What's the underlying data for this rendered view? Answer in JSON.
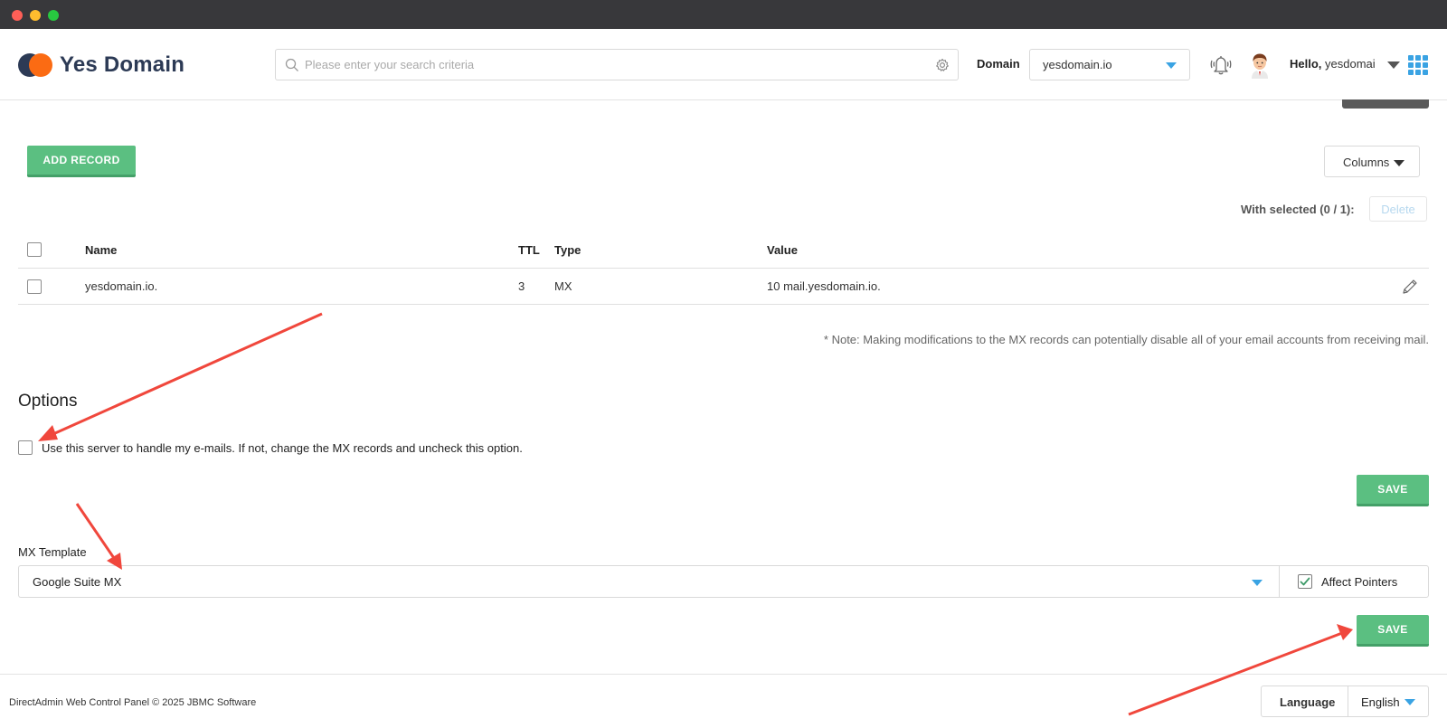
{
  "brand": {
    "name": "Yes Domain"
  },
  "search": {
    "placeholder": "Please enter your search criteria"
  },
  "header": {
    "domain_label": "Domain",
    "domain_value": "yesdomain.io",
    "hello_prefix": "Hello,",
    "username": "yesdomai"
  },
  "toolbar": {
    "add_record": "ADD RECORD",
    "columns": "Columns",
    "with_selected": "With selected (0 / 1):",
    "delete": "Delete"
  },
  "table": {
    "headers": {
      "name": "Name",
      "ttl": "TTL",
      "type": "Type",
      "value": "Value"
    },
    "rows": [
      {
        "name": "yesdomain.io.",
        "ttl": "3",
        "type": "MX",
        "value": "10 mail.yesdomain.io."
      }
    ]
  },
  "note": "* Note: Making modifications to the MX records can potentially disable all of your email accounts from receiving mail.",
  "options": {
    "title": "Options",
    "use_server_label": "Use this server to handle my e-mails. If not, change the MX records and uncheck this option.",
    "use_server_checked": false,
    "save": "SAVE"
  },
  "mx_template": {
    "label": "MX Template",
    "value": "Google Suite MX",
    "affect_pointers_label": "Affect Pointers",
    "affect_pointers_checked": true,
    "save": "SAVE"
  },
  "footer": {
    "copyright": "DirectAdmin Web Control Panel © 2025 JBMC Software",
    "language_label": "Language",
    "language_value": "English"
  },
  "icons": {
    "search": "search-icon",
    "settings": "gear-icon",
    "notifications": "bell-icon",
    "user": "avatar-icon",
    "apps": "grid-icon",
    "edit": "pencil-icon"
  },
  "colors": {
    "accent_green": "#5bbf81",
    "accent_blue": "#3aa3e3",
    "brand_navy": "#2c3a55",
    "brand_orange": "#fb6b13",
    "annotation_red": "#f0473c"
  }
}
